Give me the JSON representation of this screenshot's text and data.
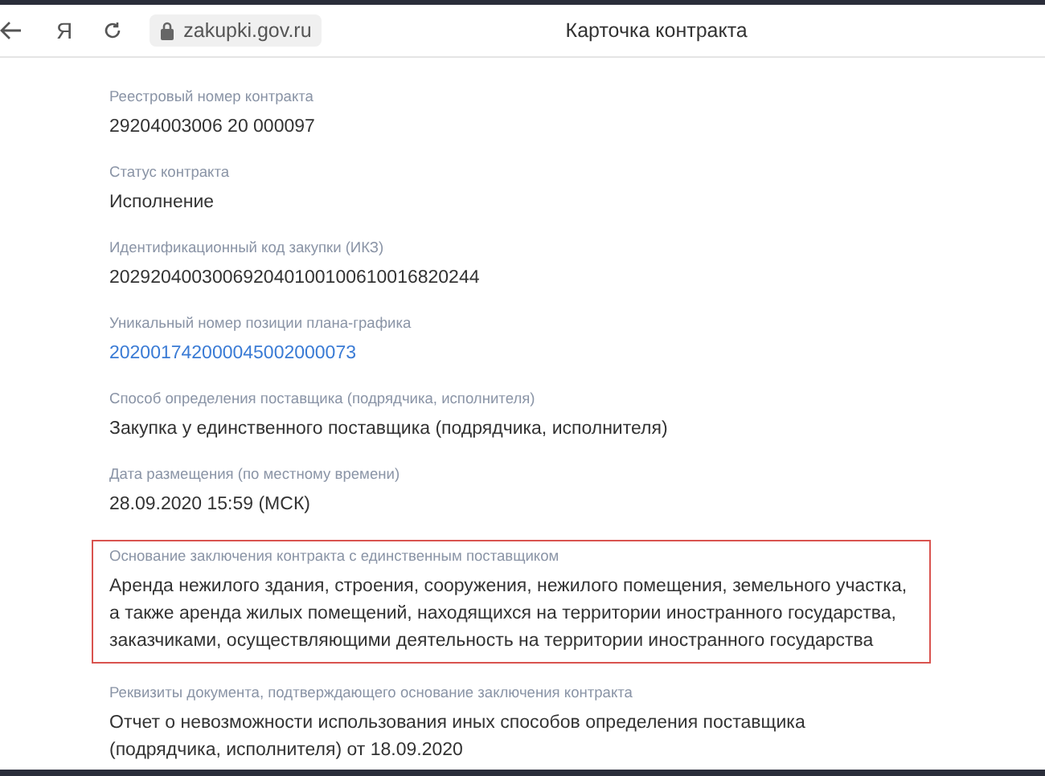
{
  "browser": {
    "address": "zakupki.gov.ru",
    "page_title": "Карточка контракта",
    "logo": "Я"
  },
  "fields": [
    {
      "label": "Реестровый номер контракта",
      "value": "29204003006 20 000097",
      "kind": "text",
      "highlighted": false
    },
    {
      "label": "Статус контракта",
      "value": "Исполнение",
      "kind": "text",
      "highlighted": false
    },
    {
      "label": "Идентификационный код закупки (ИКЗ)",
      "value": "202920400300692040100100610016820244",
      "kind": "text",
      "highlighted": false
    },
    {
      "label": "Уникальный номер позиции плана-графика",
      "value": "202001742000045002000073",
      "kind": "link",
      "highlighted": false
    },
    {
      "label": "Способ определения поставщика (подрядчика, исполнителя)",
      "value": "Закупка у единственного поставщика (подрядчика, исполнителя)",
      "kind": "text",
      "highlighted": false
    },
    {
      "label": "Дата размещения (по местному времени)",
      "value": "28.09.2020 15:59 (МСК)",
      "kind": "text",
      "highlighted": false
    },
    {
      "label": "Основание заключения контракта с единственным поставщиком",
      "value": "Аренда нежилого здания, строения, сооружения, нежилого помещения, земельного участка, а также аренда жилых помещений, находящихся на территории иностранного государства, заказчиками, осуществляющими деятельность на территории иностранного государства",
      "kind": "text",
      "highlighted": true
    },
    {
      "label": "Реквизиты документа, подтверждающего основание заключения контракта",
      "value": "Отчет о невозможности использования иных способов определения поставщика (подрядчика, исполнителя) от 18.09.2020",
      "kind": "text",
      "highlighted": false
    }
  ]
}
